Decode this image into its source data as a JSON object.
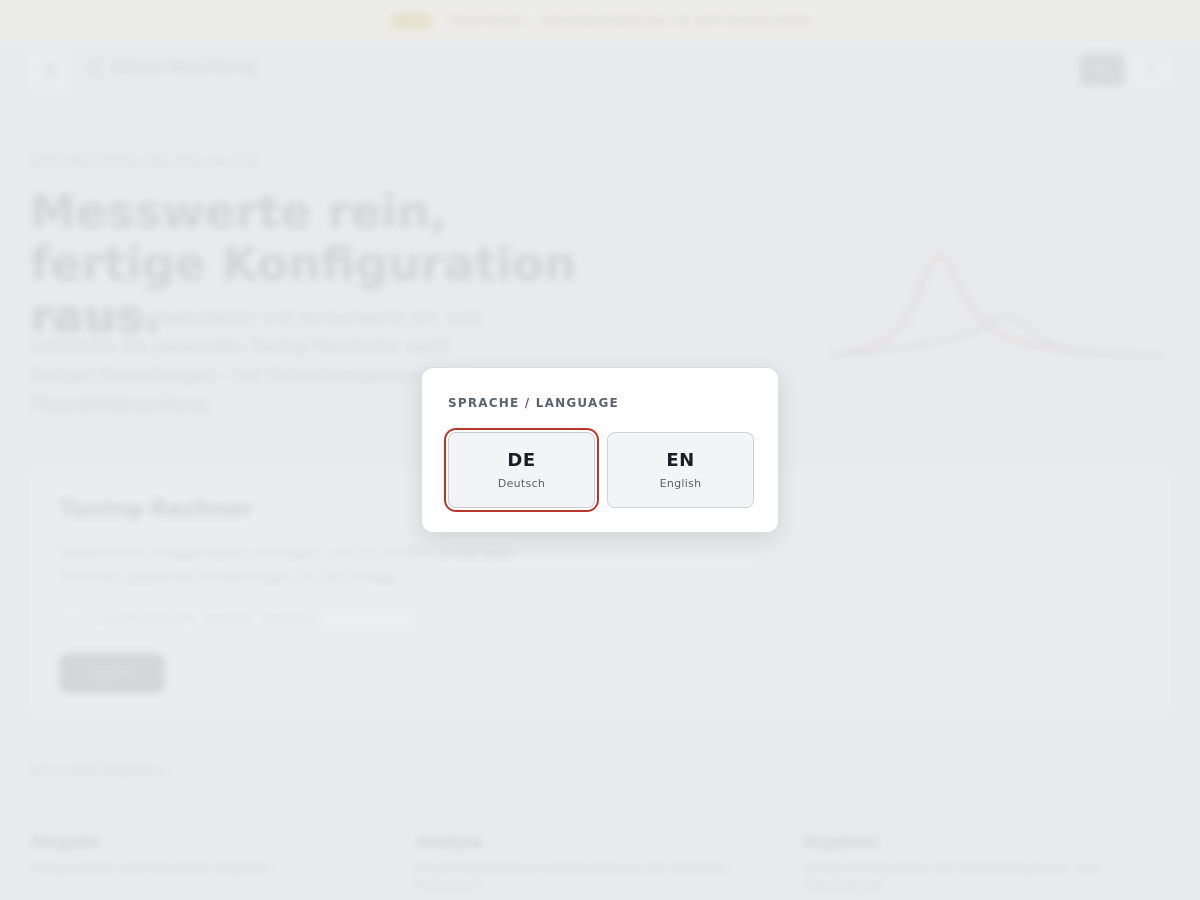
{
  "banner": {
    "badge": "BETA",
    "text": "Beta-Version – Vorschlag-Ergebnisse vor dem Einsatz prüfen"
  },
  "topbar": {
    "menu_icon": "hamburger-icon",
    "brand_icon": "document-icon",
    "brand": "Vakuum Mess-Tuning",
    "language_chip": "DE",
    "theme_icon": "sun-icon"
  },
  "hero": {
    "eyebrow": "VAKUUM-TUNING FÜR JEDE ANLAGE",
    "title": "Messwerte rein, fertige Konfiguration raus.",
    "text": "Trage deine Anlagendaten und Sensorwerte ein, und bekomme die passenden Tuning-Parameter samt fertiger Einstellungen – mit Sicherheitsgrenzen und Plausibilitätsprüfung."
  },
  "card": {
    "title": "Tuning-Rechner",
    "text": "Gewünschte Anlagendaten eintragen, und du erhältst in wenigen Schritten passende Einstellungen für die Anlage.",
    "input_placeholder": "z. B. Pumpenleistung, Volumen, Zieldruck",
    "button": "Starten"
  },
  "features": {
    "label": "SO FUNKTIONIERT'S",
    "items": [
      {
        "title": "Eingabe",
        "text": "Anlagendaten und Messwerte eingeben."
      },
      {
        "title": "Analyse",
        "text": "Plausibilitätsprüfung und Berechnung der optimalen Parameter."
      },
      {
        "title": "Ergebnis",
        "text": "Fertige Konfiguration mit Sicherheitsgrenzen zum Übernehmen."
      }
    ]
  },
  "dialog": {
    "title": "SPRACHE / LANGUAGE",
    "options": [
      {
        "code": "DE",
        "name": "Deutsch",
        "selected": true
      },
      {
        "code": "EN",
        "name": "English",
        "selected": false
      }
    ],
    "accent_color": "#b7382a"
  }
}
